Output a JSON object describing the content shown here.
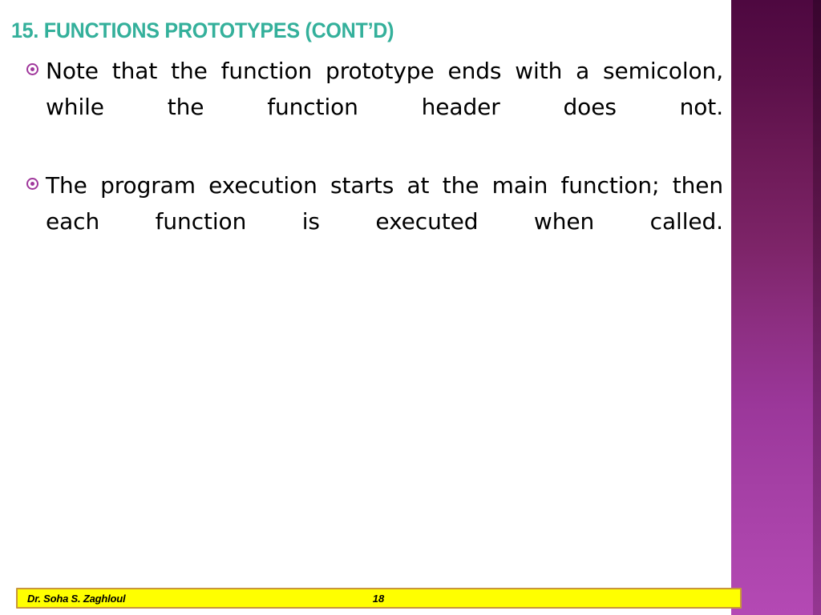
{
  "slide": {
    "title": "15. FUNCTIONS PROTOTYPES (CONT’D)",
    "title_color": "#34b09b",
    "background_color": "#ffffff",
    "bullets": [
      {
        "marker": "target-bullet-icon",
        "text": "Note that the function prototype ends with a semicolon, while the function header does not."
      },
      {
        "marker": "target-bullet-icon",
        "text": "The program execution starts at the main function; then each function is executed when called."
      }
    ]
  },
  "decoration": {
    "side_band_top_color": "#4e0840",
    "side_band_bottom_color": "#b449b4",
    "bullet_color": "#a0389c"
  },
  "footer": {
    "author": "Dr. Soha S. Zaghloul",
    "page_number": "18",
    "background_color": "#ffff00",
    "border_color": "#c8963c"
  }
}
